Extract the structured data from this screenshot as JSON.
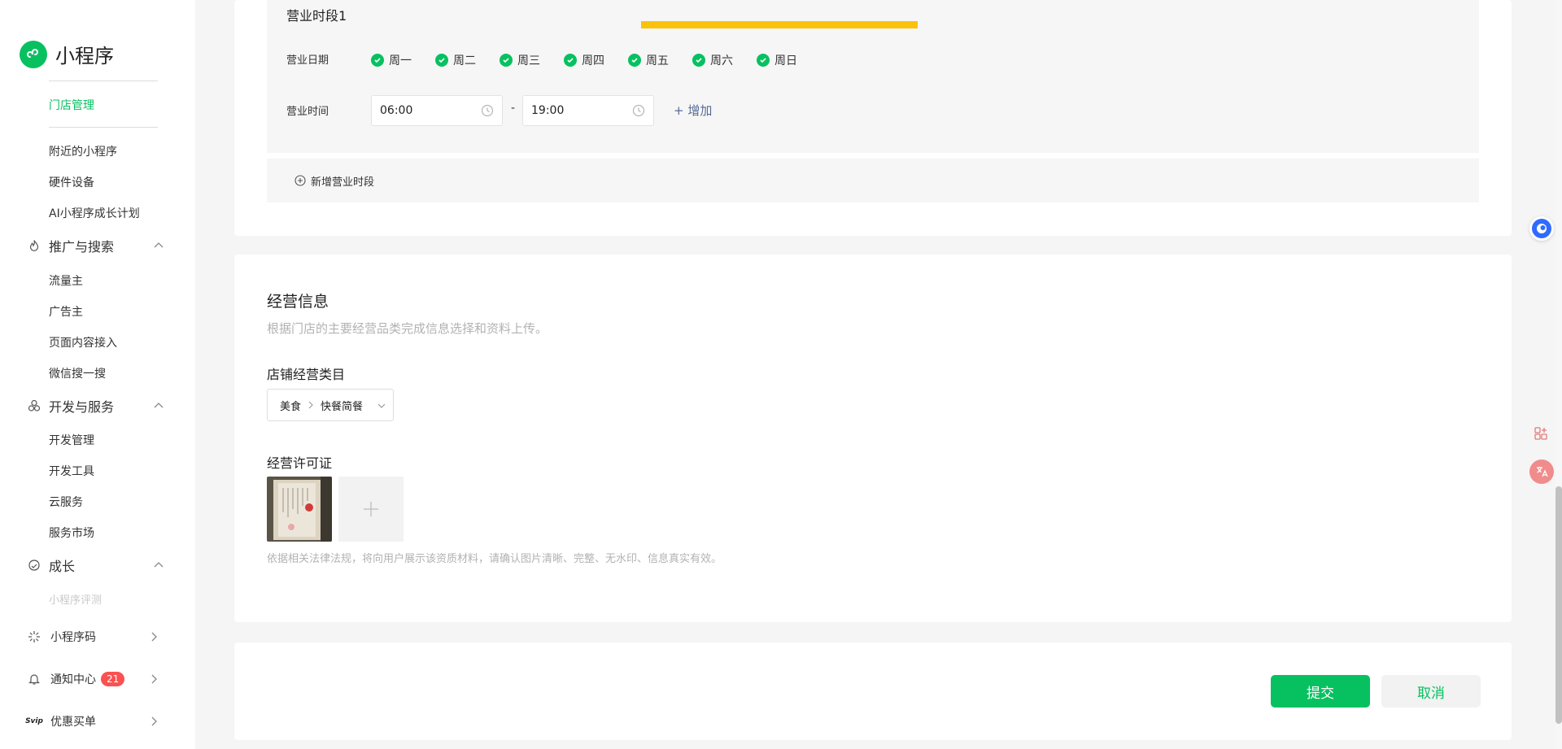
{
  "sidebar": {
    "app_name": "小程序",
    "store_section": {
      "active_item": "门店管理"
    },
    "items_top": [
      "附近的小程序",
      "硬件设备",
      "AI小程序成长计划"
    ],
    "groups": [
      {
        "label": "推广与搜索",
        "icon": "flame-icon",
        "items": [
          "流量主",
          "广告主",
          "页面内容接入",
          "微信搜一搜"
        ]
      },
      {
        "label": "开发与服务",
        "icon": "cubes-icon",
        "items": [
          "开发管理",
          "开发工具",
          "云服务",
          "服务市场"
        ]
      },
      {
        "label": "成长",
        "icon": "growth-icon",
        "items": [
          "小程序评测"
        ]
      }
    ],
    "bottom": {
      "qrcode": {
        "label": "小程序码",
        "icon": "sparkle-icon"
      },
      "notifications": {
        "label": "通知中心",
        "count": "21",
        "icon": "bell-icon"
      },
      "svip": {
        "label": "优惠买单",
        "icon_text": "Svip"
      }
    }
  },
  "business_hours": {
    "period_title": "营业时段1",
    "days_label": "营业日期",
    "days": [
      "周一",
      "周二",
      "周三",
      "周四",
      "周五",
      "周六",
      "周日"
    ],
    "time_label": "营业时间",
    "start_time": "06:00",
    "separator": "-",
    "end_time": "19:00",
    "add_label": "+ 增加",
    "add_period_label": "新增营业时段",
    "highlight_color": "#fac20a"
  },
  "business_info": {
    "title": "经营信息",
    "description": "根据门店的主要经营品类完成信息选择和资料上传。",
    "category_label": "店铺经营类目",
    "category": {
      "primary": "美食",
      "secondary": "快餐简餐"
    },
    "license_label": "经营许可证",
    "license_note": "依据相关法律法规，将向用户展示该资质材料，请确认图片清晰、完整、无水印、信息真实有效。"
  },
  "actions": {
    "submit": "提交",
    "cancel": "取消"
  },
  "colors": {
    "accent": "#07c160",
    "link": "#576b95",
    "badge": "#fa5151"
  }
}
